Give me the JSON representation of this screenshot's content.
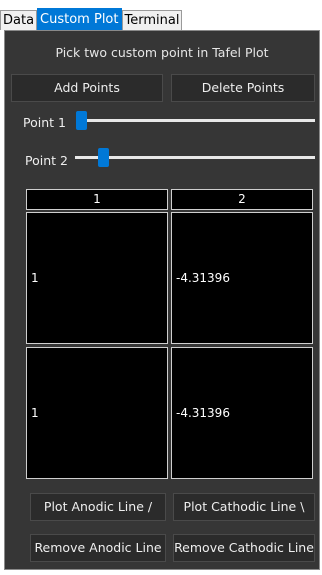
{
  "tabs": [
    {
      "label": "Data",
      "active": false
    },
    {
      "label": "Custom Plot",
      "active": true
    },
    {
      "label": "Terminal",
      "active": false
    }
  ],
  "instruction": "Pick two custom point in Tafel Plot",
  "buttons": {
    "add_points": "Add Points",
    "delete_points": "Delete Points",
    "plot_anodic": "Plot Anodic Line /",
    "plot_cathodic": "Plot Cathodic Line \\",
    "remove_anodic": "Remove Anodic Line",
    "remove_cathodic": "Remove Cathodic Line"
  },
  "sliders": [
    {
      "label": "Point 1",
      "value_fraction": 0.0
    },
    {
      "label": "Point 2",
      "value_fraction": 0.1
    }
  ],
  "table": {
    "headers": [
      "1",
      "2"
    ],
    "rows": [
      [
        "1",
        "-4.31396"
      ],
      [
        "1",
        "-4.31396"
      ]
    ]
  },
  "colors": {
    "accent": "#0078d7",
    "panel_bg": "#363636",
    "cell_bg": "#000000",
    "text": "#eeeeee"
  }
}
